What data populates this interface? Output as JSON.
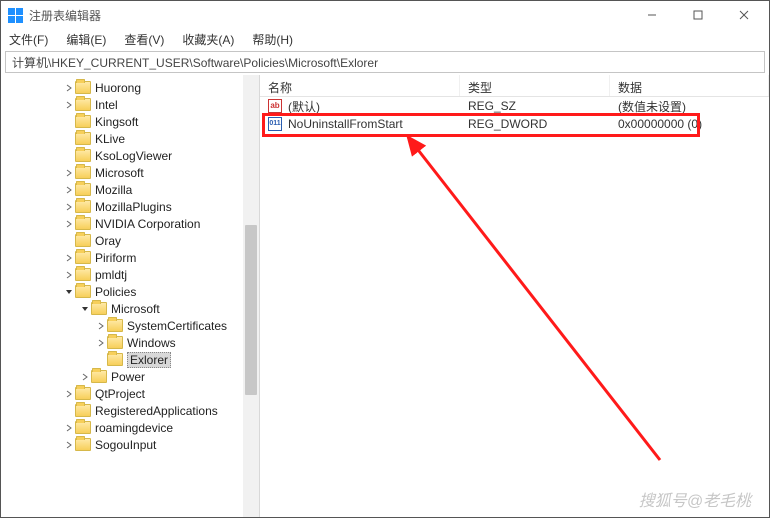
{
  "title": "注册表编辑器",
  "win": {
    "min": "—",
    "max": "☐",
    "close": "✕"
  },
  "menu": [
    "文件(F)",
    "编辑(E)",
    "查看(V)",
    "收藏夹(A)",
    "帮助(H)"
  ],
  "address": "计算机\\HKEY_CURRENT_USER\\Software\\Policies\\Microsoft\\Exlorer",
  "tree": [
    {
      "ind": 62,
      "chev": "right",
      "label": "Huorong"
    },
    {
      "ind": 62,
      "chev": "right",
      "label": "Intel"
    },
    {
      "ind": 62,
      "chev": "none",
      "label": "Kingsoft"
    },
    {
      "ind": 62,
      "chev": "none",
      "label": "KLive"
    },
    {
      "ind": 62,
      "chev": "none",
      "label": "KsoLogViewer"
    },
    {
      "ind": 62,
      "chev": "right",
      "label": "Microsoft"
    },
    {
      "ind": 62,
      "chev": "right",
      "label": "Mozilla"
    },
    {
      "ind": 62,
      "chev": "right",
      "label": "MozillaPlugins"
    },
    {
      "ind": 62,
      "chev": "right",
      "label": "NVIDIA Corporation"
    },
    {
      "ind": 62,
      "chev": "none",
      "label": "Oray"
    },
    {
      "ind": 62,
      "chev": "right",
      "label": "Piriform"
    },
    {
      "ind": 62,
      "chev": "right",
      "label": "pmldtj"
    },
    {
      "ind": 62,
      "chev": "down",
      "label": "Policies"
    },
    {
      "ind": 78,
      "chev": "down",
      "label": "Microsoft"
    },
    {
      "ind": 94,
      "chev": "right",
      "label": "SystemCertificates"
    },
    {
      "ind": 94,
      "chev": "right",
      "label": "Windows"
    },
    {
      "ind": 94,
      "chev": "none",
      "label": "Exlorer",
      "selected": true
    },
    {
      "ind": 78,
      "chev": "right",
      "label": "Power"
    },
    {
      "ind": 62,
      "chev": "right",
      "label": "QtProject"
    },
    {
      "ind": 62,
      "chev": "none",
      "label": "RegisteredApplications"
    },
    {
      "ind": 62,
      "chev": "right",
      "label": "roamingdevice"
    },
    {
      "ind": 62,
      "chev": "right",
      "label": "SogouInput"
    }
  ],
  "columns": {
    "name": "名称",
    "type": "类型",
    "data": "数据"
  },
  "rows": [
    {
      "icon": "str",
      "name": "(默认)",
      "type": "REG_SZ",
      "data": "(数值未设置)"
    },
    {
      "icon": "dw",
      "name": "NoUninstallFromStart",
      "type": "REG_DWORD",
      "data": "0x00000000 (0)"
    }
  ],
  "watermark": "搜狐号@老毛桃"
}
